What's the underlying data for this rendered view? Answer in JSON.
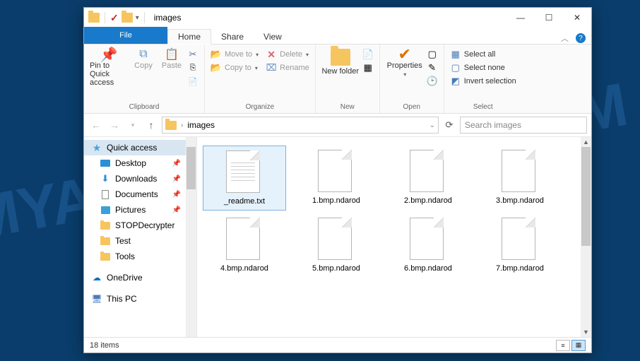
{
  "titlebar": {
    "title": "images"
  },
  "tabs": {
    "file": "File",
    "home": "Home",
    "share": "Share",
    "view": "View"
  },
  "ribbon": {
    "clipboard": {
      "label": "Clipboard",
      "pin": "Pin to Quick access",
      "copy": "Copy",
      "paste": "Paste"
    },
    "organize": {
      "label": "Organize",
      "moveto": "Move to",
      "copyto": "Copy to",
      "delete": "Delete",
      "rename": "Rename"
    },
    "new": {
      "label": "New",
      "newfolder": "New folder"
    },
    "open": {
      "label": "Open",
      "properties": "Properties"
    },
    "select": {
      "label": "Select",
      "all": "Select all",
      "none": "Select none",
      "invert": "Invert selection"
    }
  },
  "address": {
    "path": "images"
  },
  "search": {
    "placeholder": "Search images"
  },
  "sidebar": {
    "quickaccess": "Quick access",
    "desktop": "Desktop",
    "downloads": "Downloads",
    "documents": "Documents",
    "pictures": "Pictures",
    "stop": "STOPDecrypter",
    "test": "Test",
    "tools": "Tools",
    "onedrive": "OneDrive",
    "thispc": "This PC"
  },
  "files": [
    {
      "name": "_readme.txt",
      "type": "txt",
      "selected": true
    },
    {
      "name": "1.bmp.ndarod",
      "type": "blank"
    },
    {
      "name": "2.bmp.ndarod",
      "type": "blank"
    },
    {
      "name": "3.bmp.ndarod",
      "type": "blank"
    },
    {
      "name": "4.bmp.ndarod",
      "type": "blank"
    },
    {
      "name": "5.bmp.ndarod",
      "type": "blank"
    },
    {
      "name": "6.bmp.ndarod",
      "type": "blank"
    },
    {
      "name": "7.bmp.ndarod",
      "type": "blank"
    }
  ],
  "status": {
    "count": "18 items"
  }
}
